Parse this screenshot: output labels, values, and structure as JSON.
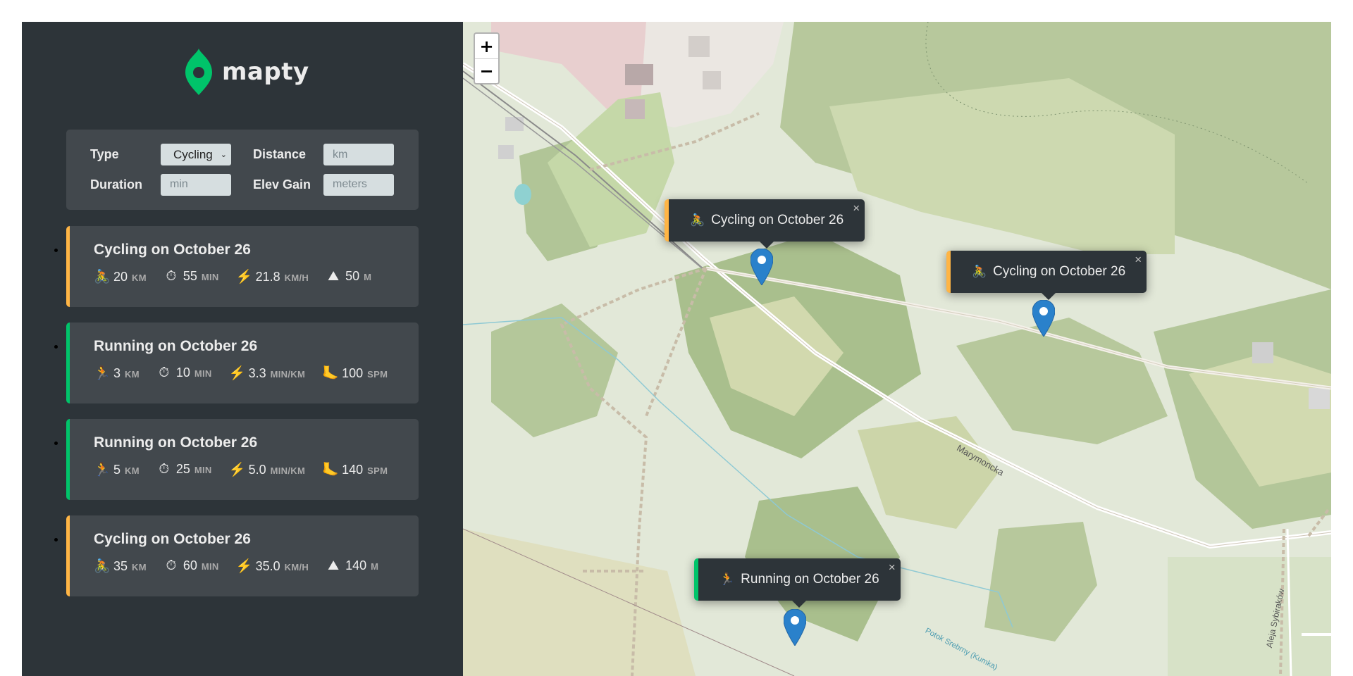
{
  "logo": {
    "text": "mapty"
  },
  "form": {
    "type_label": "Type",
    "type_value": "Cycling",
    "distance_label": "Distance",
    "distance_placeholder": "km",
    "duration_label": "Duration",
    "duration_placeholder": "min",
    "elev_label": "Elev Gain",
    "elev_placeholder": "meters"
  },
  "workouts": [
    {
      "kind": "cycling",
      "title": "Cycling on October 26",
      "details": [
        {
          "icon": "🚴",
          "value": "20",
          "unit": "km"
        },
        {
          "icon": "⏱",
          "value": "55",
          "unit": "min"
        },
        {
          "icon": "⚡",
          "value": "21.8",
          "unit": "km/h"
        },
        {
          "icon": "⛰",
          "value": "50",
          "unit": "m"
        }
      ]
    },
    {
      "kind": "running",
      "title": "Running on October 26",
      "details": [
        {
          "icon": "🏃",
          "value": "3",
          "unit": "km"
        },
        {
          "icon": "⏱",
          "value": "10",
          "unit": "min"
        },
        {
          "icon": "⚡",
          "value": "3.3",
          "unit": "min/km"
        },
        {
          "icon": "🦶",
          "value": "100",
          "unit": "spm"
        }
      ]
    },
    {
      "kind": "running",
      "title": "Running on October 26",
      "details": [
        {
          "icon": "🏃",
          "value": "5",
          "unit": "km"
        },
        {
          "icon": "⏱",
          "value": "25",
          "unit": "min"
        },
        {
          "icon": "⚡",
          "value": "5.0",
          "unit": "min/km"
        },
        {
          "icon": "🦶",
          "value": "140",
          "unit": "spm"
        }
      ]
    },
    {
      "kind": "cycling",
      "title": "Cycling on October 26",
      "details": [
        {
          "icon": "🚴",
          "value": "35",
          "unit": "km"
        },
        {
          "icon": "⏱",
          "value": "60",
          "unit": "min"
        },
        {
          "icon": "⚡",
          "value": "35.0",
          "unit": "km/h"
        },
        {
          "icon": "⛰",
          "value": "140",
          "unit": "m"
        }
      ]
    }
  ],
  "map": {
    "zoom_in": "+",
    "zoom_out": "−",
    "street_name": "Marymoncka",
    "street_name_2": "Aleja Sybiraków",
    "stream_name": "Potok Srebrny (Kumka)",
    "popups": [
      {
        "kind": "cycling",
        "icon": "🚴",
        "text": "Cycling on October 26",
        "close": "×"
      },
      {
        "kind": "cycling",
        "icon": "🚴",
        "text": "Cycling on October 26",
        "close": "×"
      },
      {
        "kind": "running",
        "icon": "🏃",
        "text": "Running on October 26",
        "close": "×"
      }
    ]
  },
  "colors": {
    "sidebar": "#2d3439",
    "panel": "#42484d",
    "cycling": "#ffb545",
    "running": "#00c46a",
    "marker": "#2a81cb"
  }
}
